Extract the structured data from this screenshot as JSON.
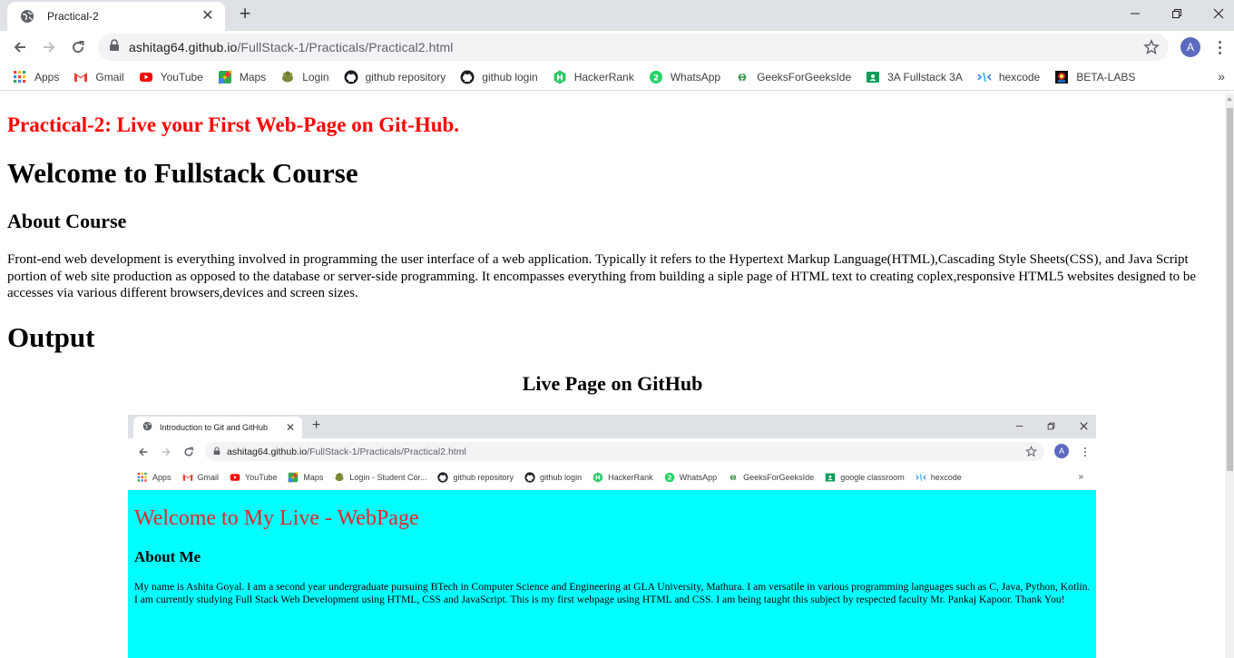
{
  "browser": {
    "tab_title": "Practical-2",
    "url_host": "ashitag64.github.io",
    "url_path": "/FullStack-1/Practicals/Practical2.html",
    "avatar_letter": "A",
    "bookmarks": [
      {
        "label": "Apps",
        "icon": "apps-grid-icon"
      },
      {
        "label": "Gmail",
        "icon": "gmail-icon"
      },
      {
        "label": "YouTube",
        "icon": "youtube-icon"
      },
      {
        "label": "Maps",
        "icon": "maps-icon"
      },
      {
        "label": "Login",
        "icon": "login-icon"
      },
      {
        "label": "github repository",
        "icon": "github-icon"
      },
      {
        "label": "github login",
        "icon": "github-icon"
      },
      {
        "label": "HackerRank",
        "icon": "hackerrank-icon"
      },
      {
        "label": "WhatsApp",
        "icon": "whatsapp-icon"
      },
      {
        "label": "GeeksForGeeksIde",
        "icon": "geeksforgeeks-icon"
      },
      {
        "label": "3A Fullstack 3A",
        "icon": "classroom-icon"
      },
      {
        "label": "hexcode",
        "icon": "hexcode-icon"
      },
      {
        "label": "BETA-LABS",
        "icon": "betalabs-icon"
      }
    ],
    "bookmarks_more": "»"
  },
  "page": {
    "subtitle": "Practical-2: Live your First Web-Page on Git-Hub.",
    "heading": "Welcome to Fullstack Course",
    "about_heading": "About Course",
    "about_text": "Front-end web development is everything involved in programming the user interface of a web application. Typically it refers to the Hypertext Markup Language(HTML),Cascading Style Sheets(CSS), and Java Script portion of web site production as opposed to the database or server-side programming. It encompasses everything from building a siple page of HTML text to creating coplex,responsive HTML5 websites designed to be accesses via various different browsers,devices and screen sizes.",
    "output_heading": "Output",
    "live_heading": "Live Page on GitHub"
  },
  "screenshot": {
    "tab_title": "Introduction to Git and GitHub",
    "url_host": "ashitag64.github.io",
    "url_path": "/FullStack-1/Practicals/Practical2.html",
    "avatar_letter": "A",
    "bookmarks": [
      {
        "label": "Apps",
        "icon": "apps-grid-icon"
      },
      {
        "label": "Gmail",
        "icon": "gmail-icon"
      },
      {
        "label": "YouTube",
        "icon": "youtube-icon"
      },
      {
        "label": "Maps",
        "icon": "maps-icon"
      },
      {
        "label": "Login - Student Cor...",
        "icon": "login-icon"
      },
      {
        "label": "github repository",
        "icon": "github-icon"
      },
      {
        "label": "github login",
        "icon": "github-icon"
      },
      {
        "label": "HackerRank",
        "icon": "hackerrank-icon"
      },
      {
        "label": "WhatsApp",
        "icon": "whatsapp-icon"
      },
      {
        "label": "GeeksForGeeksIde",
        "icon": "geeksforgeeks-icon"
      },
      {
        "label": "google classroom",
        "icon": "classroom-icon"
      },
      {
        "label": "hexcode",
        "icon": "hexcode-icon"
      }
    ],
    "bookmarks_more": "»",
    "page_heading": "Welcome to My Live - WebPage",
    "about_heading": "About Me",
    "about_text": "My name is Ashita Goyal. I am a second year undergraduate pursuing BTech in Computer Science and Engineering at GLA University, Mathura. I am versatile in various programming languages such as C, Java, Python, Kotlin. I am currently studying Full Stack Web Development using HTML, CSS and JavaScript. This is my first webpage using HTML and CSS. I am being taught this subject by respected faculty Mr. Pankaj Kapoor. Thank You!",
    "background_color": "#00ffff",
    "heading_color": "#e8262a"
  },
  "colors": {
    "subtitle_red": "#ff0000",
    "chrome_bg": "#dee1e6",
    "omnibox_bg": "#f1f3f4",
    "avatar_bg": "#5c6bc0"
  }
}
